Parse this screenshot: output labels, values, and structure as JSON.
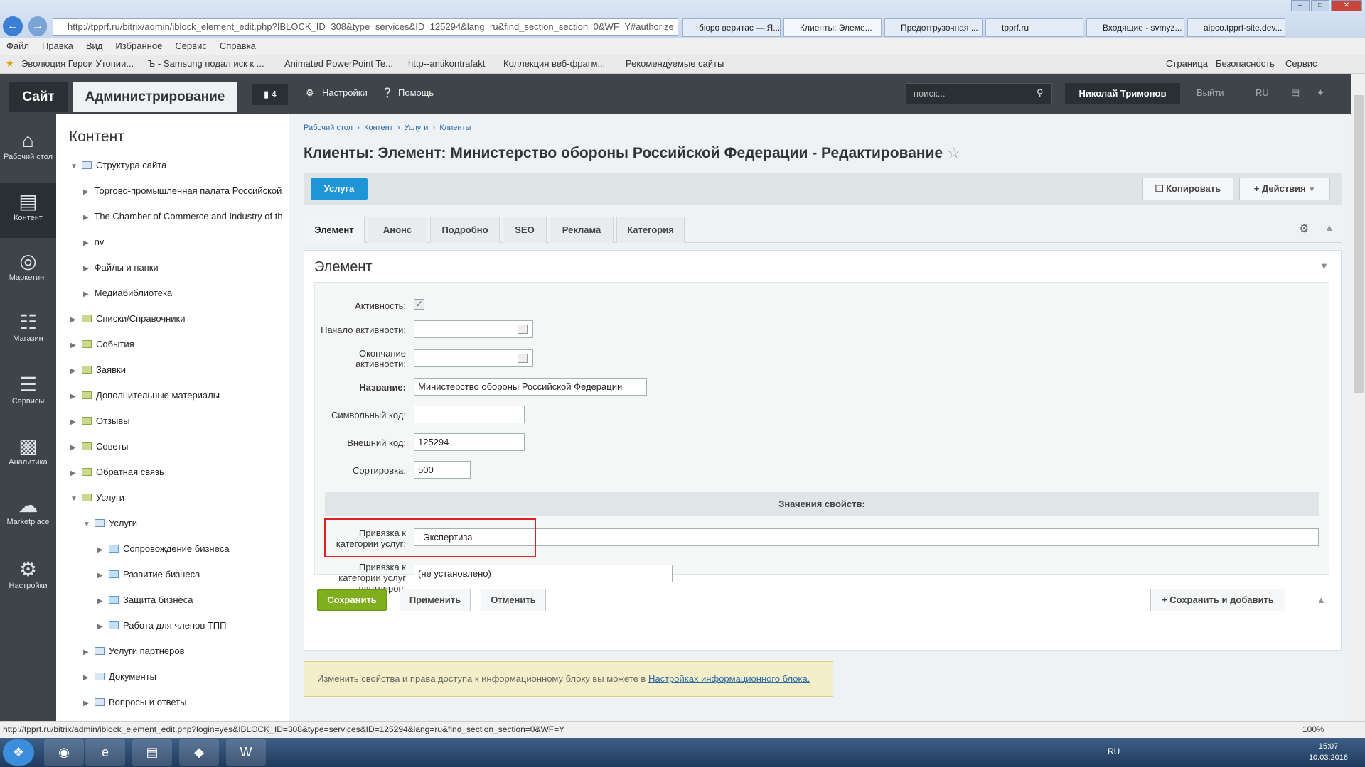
{
  "browser": {
    "url": "http://tpprf.ru/bitrix/admin/iblock_element_edit.php?IBLOCK_ID=308&type=services&ID=125294&lang=ru&find_section_section=0&WF=Y#authorize",
    "tabs": [
      "бюро веритас — Я...",
      "Клиенты: Элеме...",
      "Предотгрузочная ...",
      "tpprf.ru",
      "Входящие - svmyz...",
      "aipco.tpprf-site.dev..."
    ],
    "menu": [
      "Файл",
      "Правка",
      "Вид",
      "Избранное",
      "Сервис",
      "Справка"
    ],
    "favorites": [
      "Эволюция Герои Утопии...",
      "Ъ - Samsung подал иск к ...",
      "Animated PowerPoint Te...",
      "http--antikontrafakt",
      "Коллекция веб-фрагм...",
      "Рекомендуемые сайты"
    ],
    "right_tools": [
      "Страница",
      "Безопасность",
      "Сервис"
    ],
    "status_url": "http://tpprf.ru/bitrix/admin/iblock_element_edit.php?login=yes&IBLOCK_ID=308&type=services&ID=125294&lang=ru&find_section_section=0&WF=Y",
    "zoom": "100%"
  },
  "topbar": {
    "site_tab": "Сайт",
    "admin_tab": "Администрирование",
    "notifications": "4",
    "settings": "Настройки",
    "help": "Помощь",
    "search_placeholder": "поиск...",
    "user": "Николай Тримонов",
    "logout": "Выйти",
    "lang": "RU"
  },
  "left_menu": [
    "Рабочий стол",
    "Контент",
    "Маркетинг",
    "Магазин",
    "Сервисы",
    "Аналитика",
    "Marketplace",
    "Настройки"
  ],
  "tree": {
    "title": "Контент",
    "items": [
      "Структура сайта",
      "Торгово-промышленная палата Российской",
      "The Chamber of Commerce and Industry of th",
      "nv",
      "Файлы и папки",
      "Медиабиблиотека",
      "Списки/Справочники",
      "События",
      "Заявки",
      "Дополнительные материалы",
      "Отзывы",
      "Советы",
      "Обратная связь",
      "Услуги",
      "Услуги",
      "Сопровождение бизнеса",
      "Развитие бизнеса",
      "Защита бизнеса",
      "Работа для членов ТПП",
      "Услуги партнеров",
      "Документы",
      "Вопросы и ответы"
    ]
  },
  "breadcrumb": [
    "Рабочий стол",
    "Контент",
    "Услуги",
    "Клиенты"
  ],
  "page_title": "Клиенты: Элемент: Министерство обороны Российской Федерации - Редактирование",
  "context": {
    "usluga": "Услуга",
    "copy": "Копировать",
    "actions": "Действия"
  },
  "tabs": [
    "Элемент",
    "Анонс",
    "Подробно",
    "SEO",
    "Реклама",
    "Категория"
  ],
  "form": {
    "section_title": "Элемент",
    "active_label": "Активность:",
    "start_label": "Начало активности:",
    "end_label_1": "Окончание",
    "end_label_2": "активности:",
    "name_label": "Название:",
    "name_value": "Министерство обороны Российской Федерации",
    "code_label": "Символьный код:",
    "code_value": "",
    "xml_label": "Внешний код:",
    "xml_value": "125294",
    "sort_label": "Сортировка:",
    "sort_value": "500",
    "props_title": "Значения свойств:",
    "cat_label_1": "Привязка к",
    "cat_label_2": "категории услуг:",
    "cat_value": ". Экспертиза",
    "pcat_label_1": "Привязка к",
    "pcat_label_2": "категории услуг",
    "pcat_label_3": "партнеров:",
    "pcat_value": "(не установлено)"
  },
  "buttons": {
    "save": "Сохранить",
    "apply": "Применить",
    "cancel": "Отменить",
    "save_add": "Сохранить и добавить"
  },
  "note": {
    "text": "Изменить свойства и права доступа к информационному блоку вы можете в",
    "link": "Настройках информационного блока."
  },
  "taskbar": {
    "lang": "RU",
    "time": "15:07",
    "date": "10.03.2016"
  }
}
